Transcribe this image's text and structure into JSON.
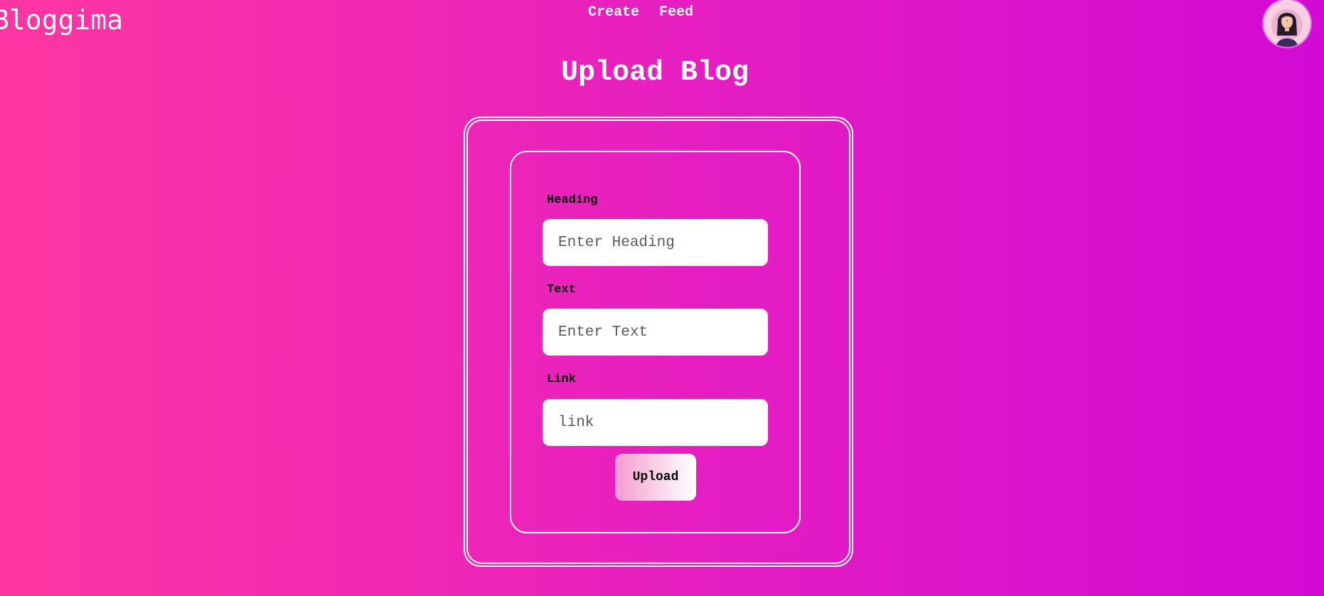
{
  "header": {
    "brand": "Bloggima",
    "nav": [
      {
        "label": "Create"
      },
      {
        "label": "Feed"
      }
    ]
  },
  "page": {
    "title": "Upload Blog"
  },
  "form": {
    "heading": {
      "label": "Heading",
      "placeholder": "Enter Heading",
      "value": ""
    },
    "text": {
      "label": "Text",
      "placeholder": "Enter Text",
      "value": ""
    },
    "link": {
      "label": "Link",
      "placeholder": "link",
      "value": ""
    },
    "submit_label": "Upload"
  },
  "colors": {
    "background_start": "#ff36a1",
    "background_end": "#d20ad4",
    "text": "#ffffff",
    "label": "#000000"
  },
  "icons": {
    "avatar": "user-avatar-icon"
  }
}
